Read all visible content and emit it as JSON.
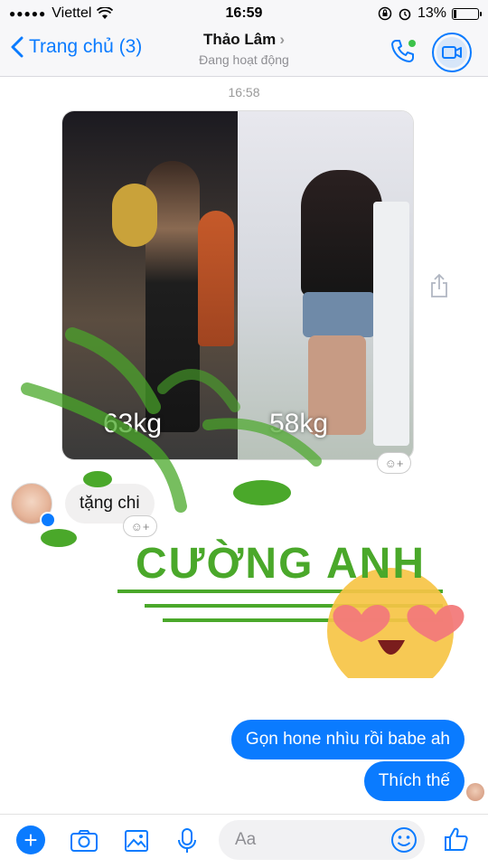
{
  "status_bar": {
    "carrier": "Viettel",
    "time": "16:59",
    "battery": "13%",
    "battery_level": 0.13
  },
  "header": {
    "back_label": "Trang chủ (3)",
    "title": "Thảo Lâm",
    "subtitle": "Đang hoạt động"
  },
  "chat": {
    "timestamp": "16:58",
    "photo_left_caption": "63kg",
    "photo_right_caption": "58kg",
    "incoming_text": "tặng chi",
    "outgoing_1": "Gọn hone nhìu rồi babe ah",
    "outgoing_2": "Thích thế"
  },
  "watermark": {
    "text": "CƯỜNG ANH"
  },
  "composer": {
    "placeholder": "Aa"
  },
  "colors": {
    "accent": "#0a7bff",
    "watermark_green": "#4aa82a"
  }
}
